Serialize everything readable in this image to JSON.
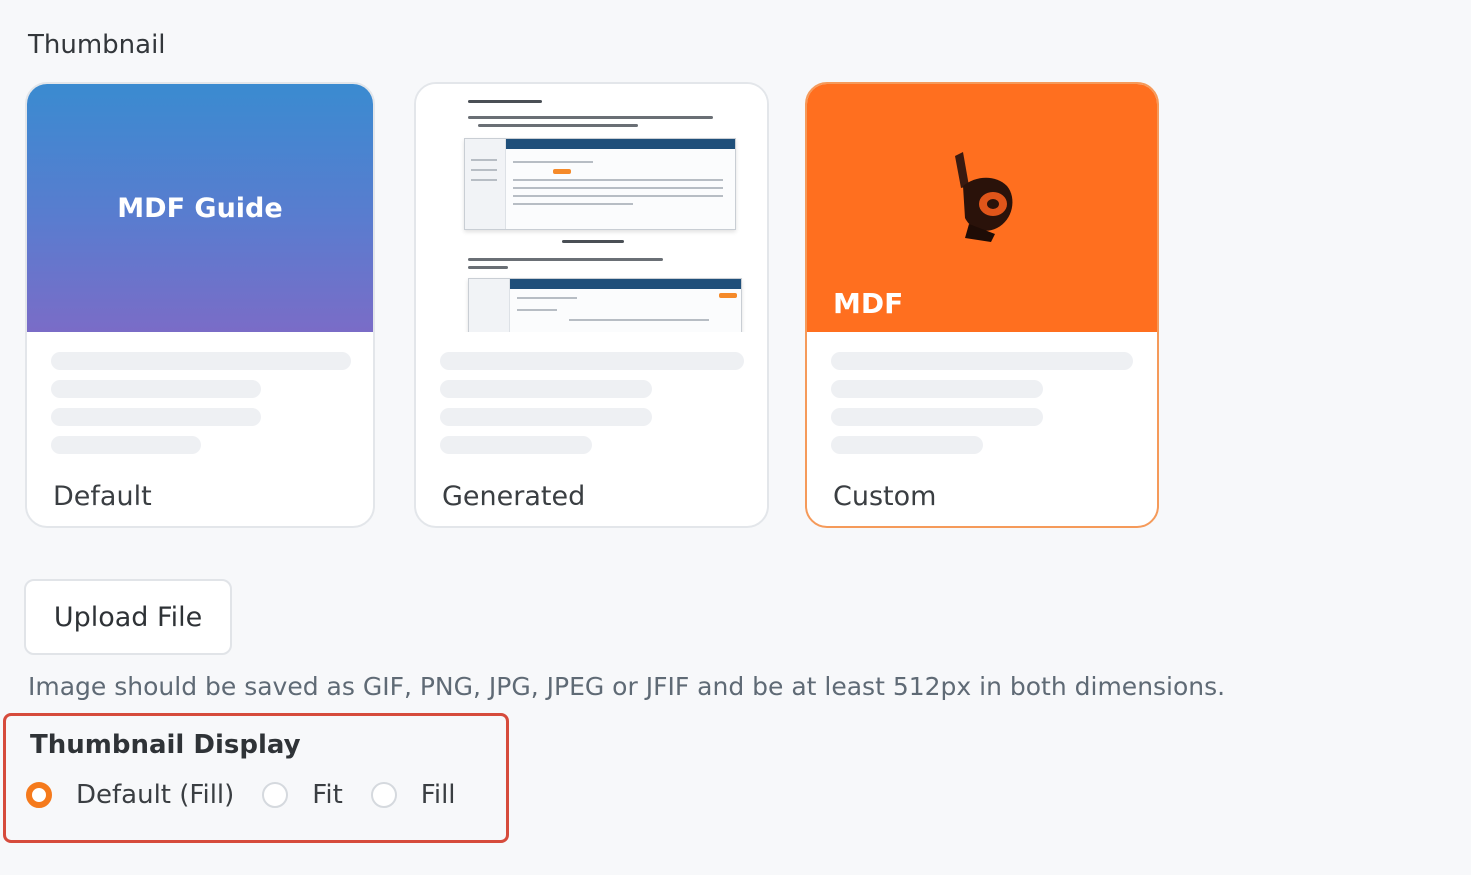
{
  "section": {
    "title": "Thumbnail"
  },
  "cards": [
    {
      "thumb_title": "MDF Guide",
      "label": "Default",
      "selected": false
    },
    {
      "thumb_title": "",
      "label": "Generated",
      "selected": false
    },
    {
      "thumb_title": "MDF",
      "label": "Custom",
      "selected": true
    }
  ],
  "upload": {
    "label": "Upload File"
  },
  "hint": "Image should be saved as GIF, PNG, JPG, JPEG or JFIF and be at least 512px in both dimensions.",
  "display": {
    "title": "Thumbnail Display",
    "options": [
      {
        "label": "Default (Fill)",
        "checked": true
      },
      {
        "label": "Fit",
        "checked": false
      },
      {
        "label": "Fill",
        "checked": false
      }
    ]
  },
  "colors": {
    "accent": "#f57a1c",
    "custom_thumb": "#ff6f1f",
    "highlight_border": "#d64b3c",
    "selected_card_border": "#f59a5a"
  }
}
